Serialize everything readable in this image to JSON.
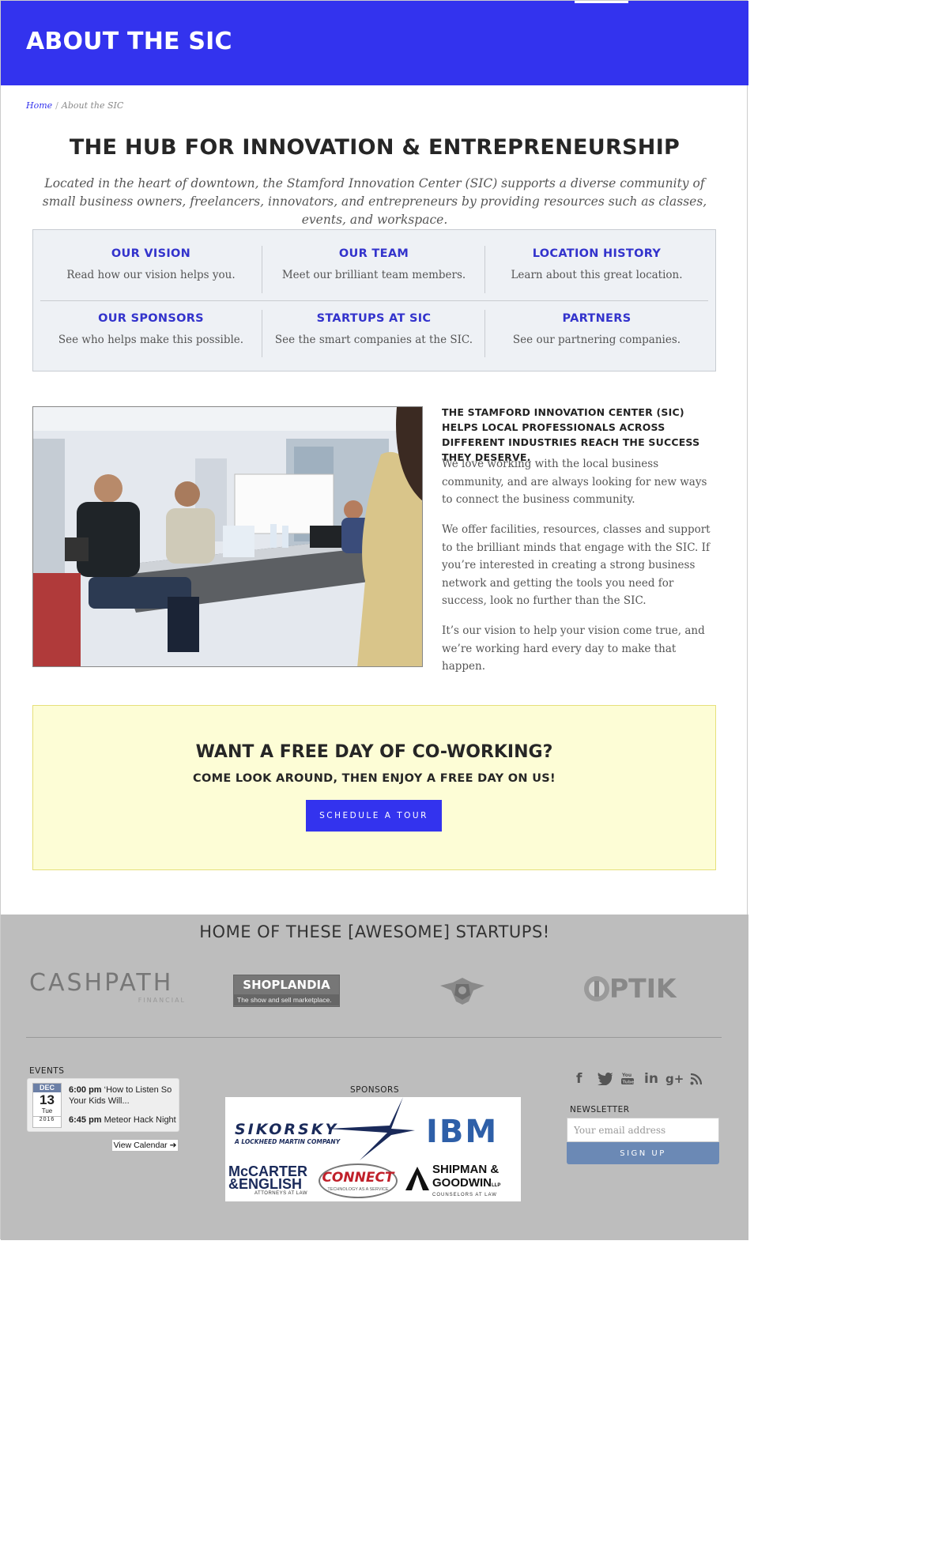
{
  "header": {
    "title": "ABOUT THE SIC"
  },
  "breadcrumb": {
    "home": "Home",
    "separator": "/",
    "current": "About the SIC"
  },
  "main": {
    "headline": "THE HUB FOR INNOVATION & ENTREPRENEURSHIP",
    "intro": "Located in the heart of downtown, the Stamford Innovation Center (SIC) supports a diverse community of small business owners, freelancers, innovators, and entrepreneurs by providing resources such as classes, events, and workspace."
  },
  "links": [
    {
      "title": "OUR VISION",
      "desc": "Read how our vision helps you."
    },
    {
      "title": "OUR TEAM",
      "desc": "Meet our brilliant team members."
    },
    {
      "title": "LOCATION HISTORY",
      "desc": "Learn about this great location."
    },
    {
      "title": "OUR SPONSORS",
      "desc": "See who helps make this possible."
    },
    {
      "title": "STARTUPS AT SIC",
      "desc": "See the smart companies at the SIC."
    },
    {
      "title": "PARTNERS",
      "desc": "See our partnering companies."
    }
  ],
  "about": {
    "heading": "THE STAMFORD INNOVATION CENTER (SIC) HELPS LOCAL PROFESSIONALS ACROSS DIFFERENT INDUSTRIES REACH THE SUCCESS THEY DESERVE.",
    "p1": "We love working with the local business community, and are always looking for new ways to connect the business community.",
    "p2": "We offer facilities, resources, classes and support to the brilliant minds that engage with the SIC. If you’re interested in creating a strong business network and getting the tools you need for success, look no further than the SIC.",
    "p3": "It’s our vision to help your vision come true, and we’re working hard every day to make that happen."
  },
  "cta": {
    "title": "WANT A FREE DAY OF CO-WORKING?",
    "subtitle": "COME LOOK AROUND, THEN ENJOY A FREE DAY ON US!",
    "button": "SCHEDULE A TOUR"
  },
  "footer": {
    "startups_heading": "HOME OF THESE [AWESOME] STARTUPS!",
    "startups": {
      "cashpath": "CASHPATH",
      "cashpath_sub": "FINANCIAL",
      "shoplandia": "SHOPLANDIA",
      "shoplandia_tag": "The show and sell marketplace.",
      "optik": "PTIK"
    },
    "events": {
      "heading": "EVENTS",
      "month": "DEC",
      "day": "13",
      "weekday": "Tue",
      "year": "2016",
      "items": [
        {
          "time": "6:00 pm",
          "title": "‘How to Listen So Your Kids Will..."
        },
        {
          "time": "6:45 pm",
          "title": "Meteor Hack Night"
        }
      ],
      "view_calendar": "View Calendar"
    },
    "sponsors": {
      "heading": "SPONSORS",
      "sikorsky": "SIKORSKY",
      "sikorsky_sub": "A LOCKHEED MARTIN COMPANY",
      "ibm": "IBM",
      "mccarter": "McCARTER",
      "english": "&ENGLISH",
      "mccarter_sub": "ATTORNEYS AT LAW",
      "connect": "CONNECT",
      "connect_sub": "TECHNOLOGY AS A SERVICE",
      "shipman": "SHIPMAN &",
      "goodwin": "GOODWIN",
      "goodwin_llp": "LLP",
      "shipman_sub": "COUNSELORS AT LAW"
    },
    "newsletter": {
      "heading": "NEWSLETTER",
      "placeholder": "Your email address",
      "button": "SIGN UP"
    }
  },
  "colors": {
    "brand": "#3333ee",
    "cta_bg": "#fdfdd6",
    "footer_bg": "#bdbdbd",
    "signup": "#6b89b5"
  }
}
